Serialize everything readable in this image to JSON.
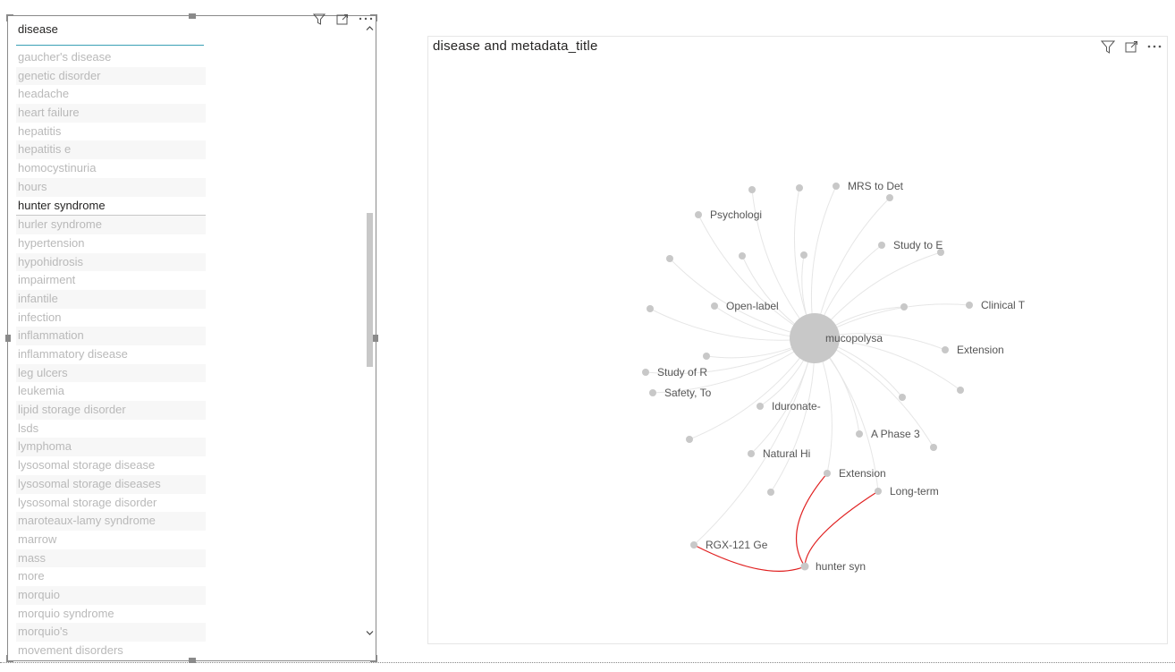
{
  "slicer": {
    "title": "disease",
    "items": [
      {
        "label": "gaucher's disease",
        "selected": false
      },
      {
        "label": "genetic disorder",
        "selected": false
      },
      {
        "label": "headache",
        "selected": false
      },
      {
        "label": "heart failure",
        "selected": false
      },
      {
        "label": "hepatitis",
        "selected": false
      },
      {
        "label": "hepatitis e",
        "selected": false
      },
      {
        "label": "homocystinuria",
        "selected": false
      },
      {
        "label": "hours",
        "selected": false
      },
      {
        "label": "hunter syndrome",
        "selected": true
      },
      {
        "label": "hurler syndrome",
        "selected": false
      },
      {
        "label": "hypertension",
        "selected": false
      },
      {
        "label": "hypohidrosis",
        "selected": false
      },
      {
        "label": "impairment",
        "selected": false
      },
      {
        "label": "infantile",
        "selected": false
      },
      {
        "label": "infection",
        "selected": false
      },
      {
        "label": "inflammation",
        "selected": false
      },
      {
        "label": "inflammatory disease",
        "selected": false
      },
      {
        "label": "leg ulcers",
        "selected": false
      },
      {
        "label": "leukemia",
        "selected": false
      },
      {
        "label": "lipid storage disorder",
        "selected": false
      },
      {
        "label": "lsds",
        "selected": false
      },
      {
        "label": "lymphoma",
        "selected": false
      },
      {
        "label": "lysosomal storage disease",
        "selected": false
      },
      {
        "label": "lysosomal storage diseases",
        "selected": false
      },
      {
        "label": "lysosomal storage disorder",
        "selected": false
      },
      {
        "label": "maroteaux-lamy syndrome",
        "selected": false
      },
      {
        "label": "marrow",
        "selected": false
      },
      {
        "label": "mass",
        "selected": false
      },
      {
        "label": "more",
        "selected": false
      },
      {
        "label": "morquio",
        "selected": false
      },
      {
        "label": "morquio syndrome",
        "selected": false
      },
      {
        "label": "morquio's",
        "selected": false
      },
      {
        "label": "movement disorders",
        "selected": false
      }
    ],
    "icons": [
      "filter-icon",
      "focus-mode-icon",
      "more-options-icon"
    ]
  },
  "network": {
    "title": "disease and metadata_title",
    "icons": [
      "filter-icon",
      "focus-mode-icon",
      "more-options-icon"
    ],
    "colors": {
      "node": "#c8c8c8",
      "edge": "#e6e6e6",
      "highlight_edge": "#e02020",
      "label": "#555555"
    },
    "hub_label": "mucopolysa",
    "secondary_hub_label": "hunter syn",
    "node_labels": [
      "MRS to Det",
      "Psychologi",
      "Study to E",
      "Clinical T",
      "Open-label",
      "Extension",
      "Study of R",
      "Safety, To",
      "Iduronate-",
      "A Phase 3",
      "Natural Hi",
      "Extension",
      "Long-term",
      "RGX-121 Ge"
    ]
  }
}
